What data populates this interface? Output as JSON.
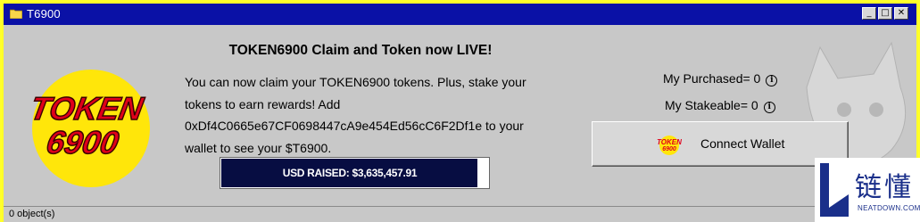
{
  "window": {
    "title": "T6900",
    "controls": {
      "minimize": "_",
      "maximize": "□",
      "close": "✕"
    }
  },
  "logo": {
    "line1": "TOKEN",
    "line2": "6900"
  },
  "announcement": {
    "headline": "TOKEN6900 Claim and Token now LIVE!",
    "body": "You can now claim your TOKEN6900 tokens. Plus, stake your tokens to earn rewards! Add 0xDf4C0665e67CF0698447cA9e454Ed56cC6F2Df1e to your wallet to see your $T6900."
  },
  "fundraise": {
    "label": "USD RAISED: $3,635,457.91",
    "progress_percent": 96
  },
  "stats": {
    "purchased": "My Purchased= 0",
    "stakeable": "My Stakeable= 0",
    "info_glyph": "i"
  },
  "connect": {
    "label": "Connect Wallet",
    "logo_line1": "TOKEN",
    "logo_line2": "6900"
  },
  "status": {
    "text": "0 object(s)"
  },
  "watermark": {
    "zh": "链懂",
    "en": "NEATDOWN.COM"
  },
  "colors": {
    "frame": "#ffff2a",
    "titlebar": "#0a11a6",
    "panel": "#c8c8c8",
    "raise_fill": "#070d42",
    "logo_red": "#e0001a",
    "logo_yellow": "#ffe60a"
  },
  "icons": [
    "folder-icon",
    "minimize-icon",
    "maximize-icon",
    "close-icon",
    "info-icon",
    "token-logo"
  ]
}
